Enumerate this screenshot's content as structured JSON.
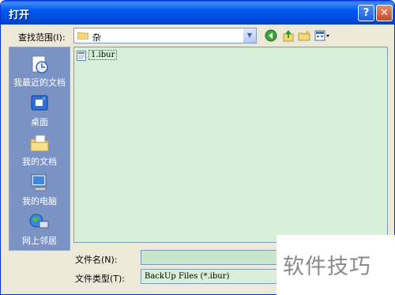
{
  "window": {
    "title": "打开"
  },
  "titlebar_buttons": {
    "help": "?",
    "close": "✕"
  },
  "lookin": {
    "label": "查找范围(I):",
    "value": "杂"
  },
  "toolbar_icons": [
    "back-icon",
    "up-folder-icon",
    "new-folder-icon",
    "views-menu-icon"
  ],
  "places": [
    {
      "label": "我最近的文档",
      "icon": "recent-documents-icon"
    },
    {
      "label": "桌面",
      "icon": "desktop-icon"
    },
    {
      "label": "我的文档",
      "icon": "my-documents-icon"
    },
    {
      "label": "我的电脑",
      "icon": "my-computer-icon"
    },
    {
      "label": "网上邻居",
      "icon": "network-places-icon"
    }
  ],
  "files": [
    {
      "name": "1.ibur",
      "icon": "file-icon"
    }
  ],
  "filename": {
    "label": "文件名(N):",
    "value": ""
  },
  "filetype": {
    "label": "文件类型(T):",
    "value": "BackUp Files (*.ibur)"
  },
  "watermark": {
    "text": "软件技巧"
  },
  "colors": {
    "title_bar": "#0058ee",
    "places_bar": "#7b93c4",
    "list_bg": "#d8f0d8",
    "dialog_bg": "#ece9d8"
  }
}
